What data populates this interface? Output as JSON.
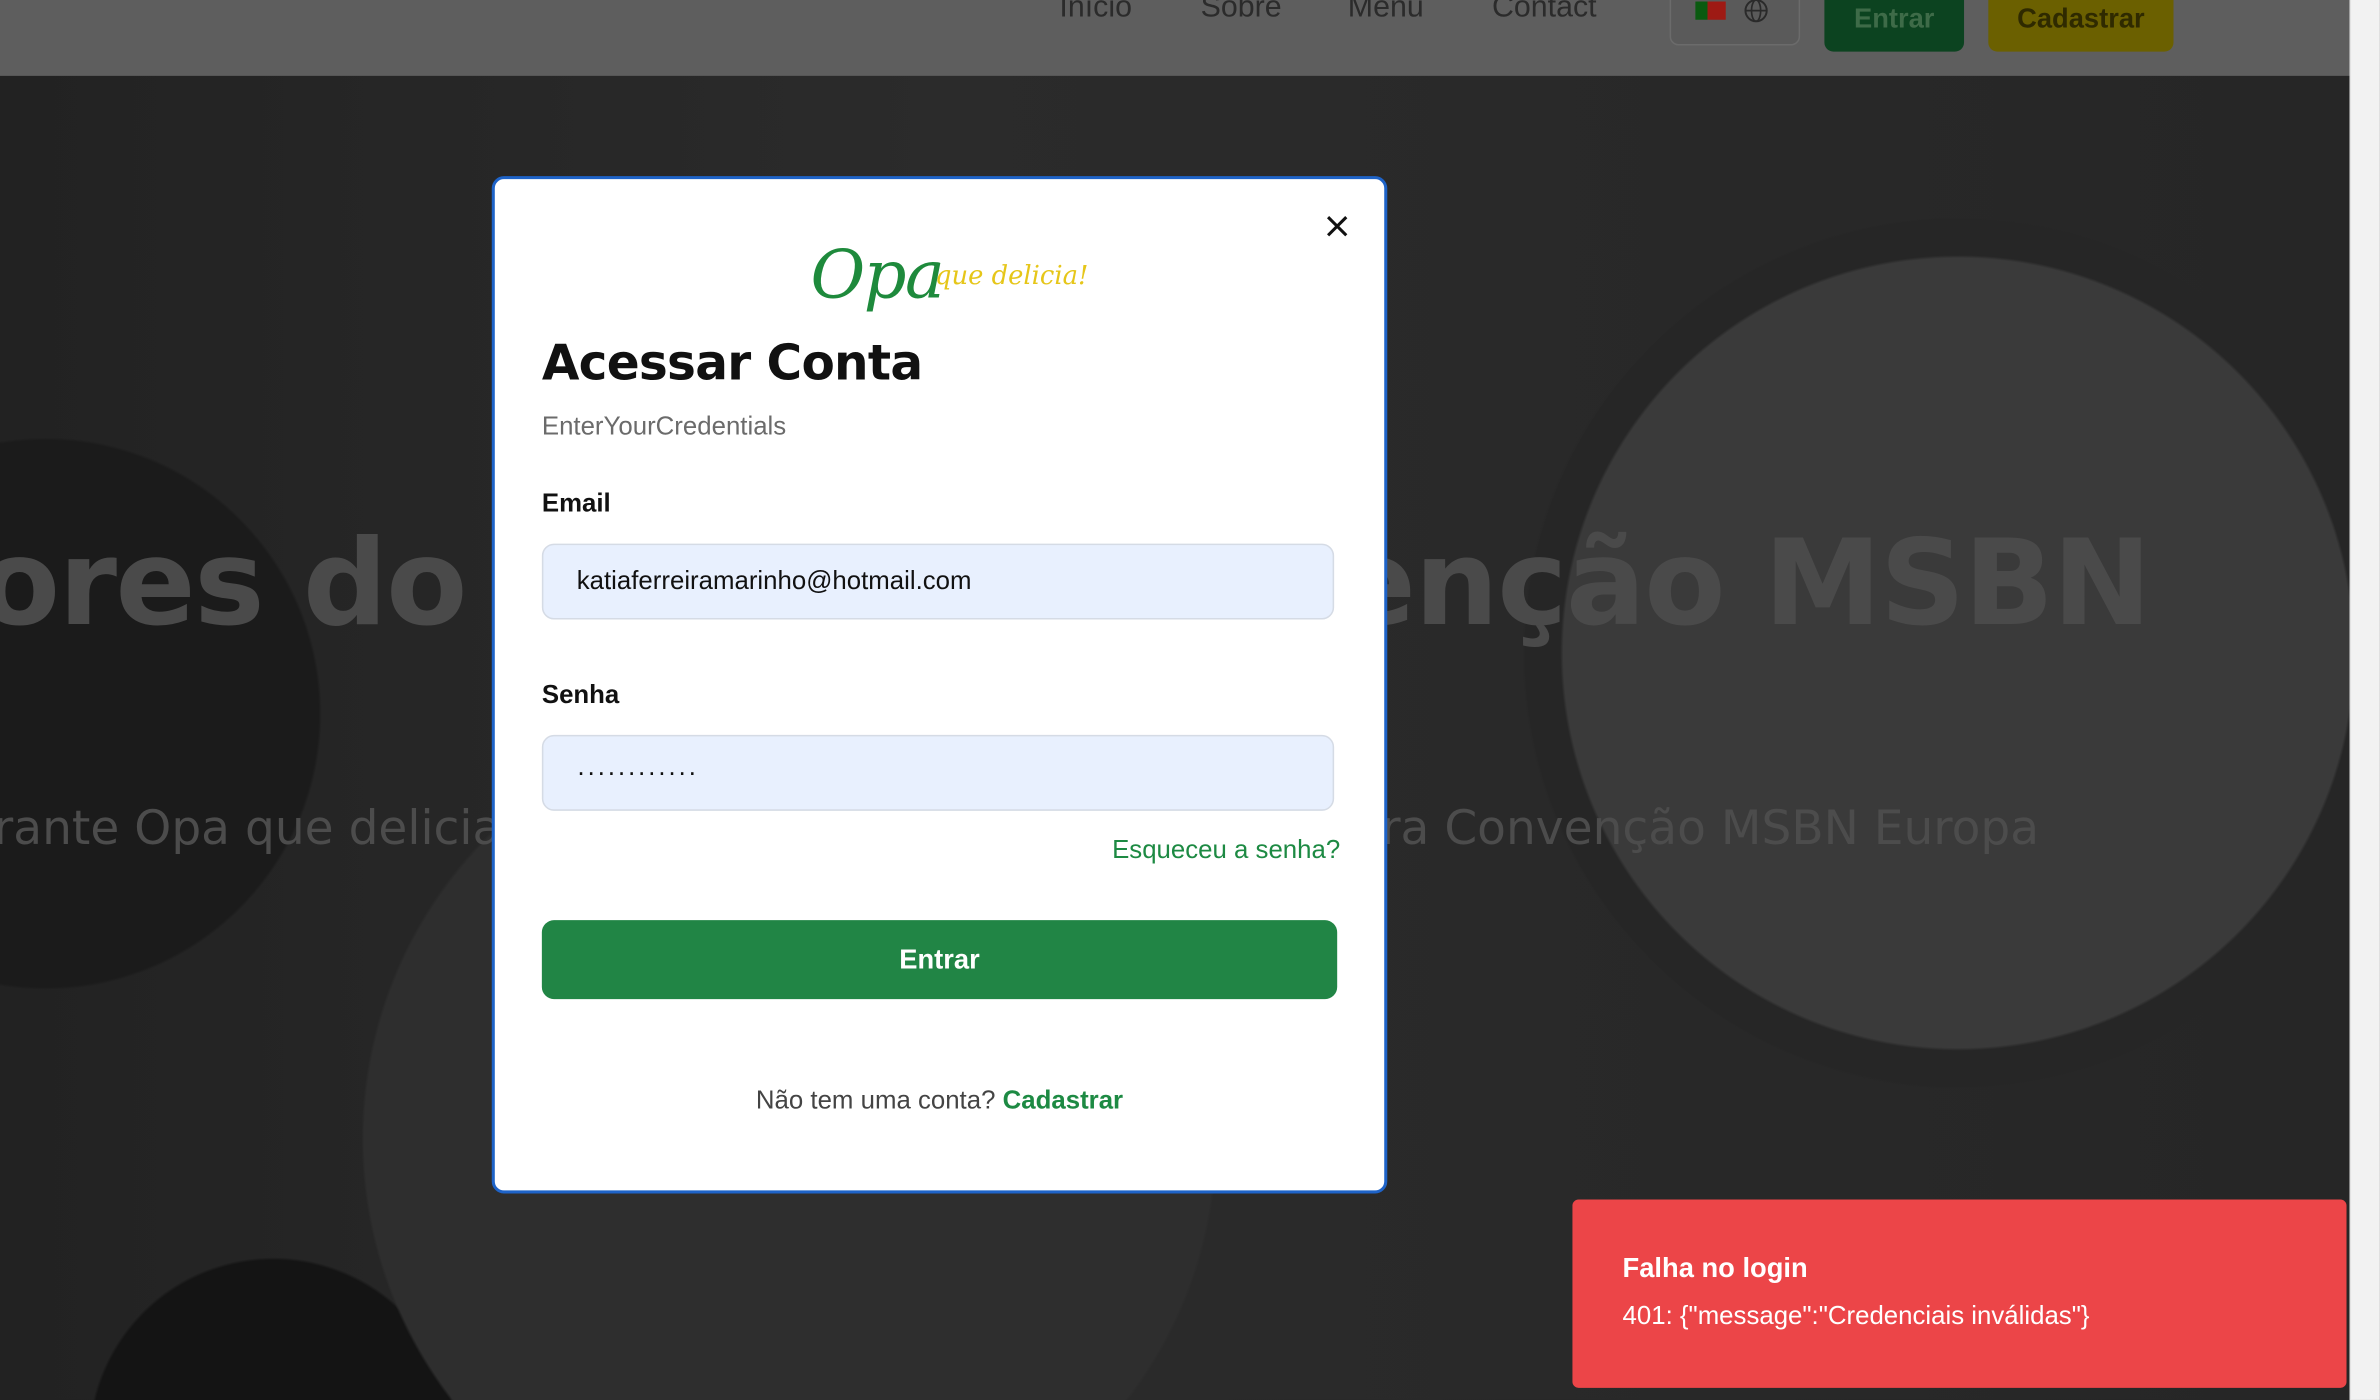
{
  "header": {
    "nav": [
      "Início",
      "Sobre",
      "Menu",
      "Contact"
    ],
    "login_label": "Entrar",
    "signup_label": "Cadastrar",
    "language_flag": "pt-flag",
    "language_icon": "globe-icon"
  },
  "hero": {
    "title_left": "ores do B",
    "title_right": "enção MSBN",
    "subtitle_left": "rante Opa que delicia",
    "subtitle_right": "ra Convenção MSBN Europa"
  },
  "modal": {
    "logo_main": "Opa",
    "logo_tagline": "que delicia!",
    "title": "Acessar Conta",
    "subtitle": "EnterYourCredentials",
    "email_label": "Email",
    "email_value": "katiaferreiramarinho@hotmail.com",
    "password_label": "Senha",
    "password_value": "············",
    "forgot_label": "Esqueceu a senha?",
    "submit_label": "Entrar",
    "no_account_text": "Não tem uma conta?",
    "signup_label": "Cadastrar"
  },
  "toast": {
    "title": "Falha no login",
    "message": "401: {\"message\":\"Credenciais inválidas\"}"
  },
  "colors": {
    "brand_green": "#218545",
    "brand_yellow": "#e6c619",
    "error_red": "#ec4548",
    "focus_blue": "#1e63c8"
  }
}
